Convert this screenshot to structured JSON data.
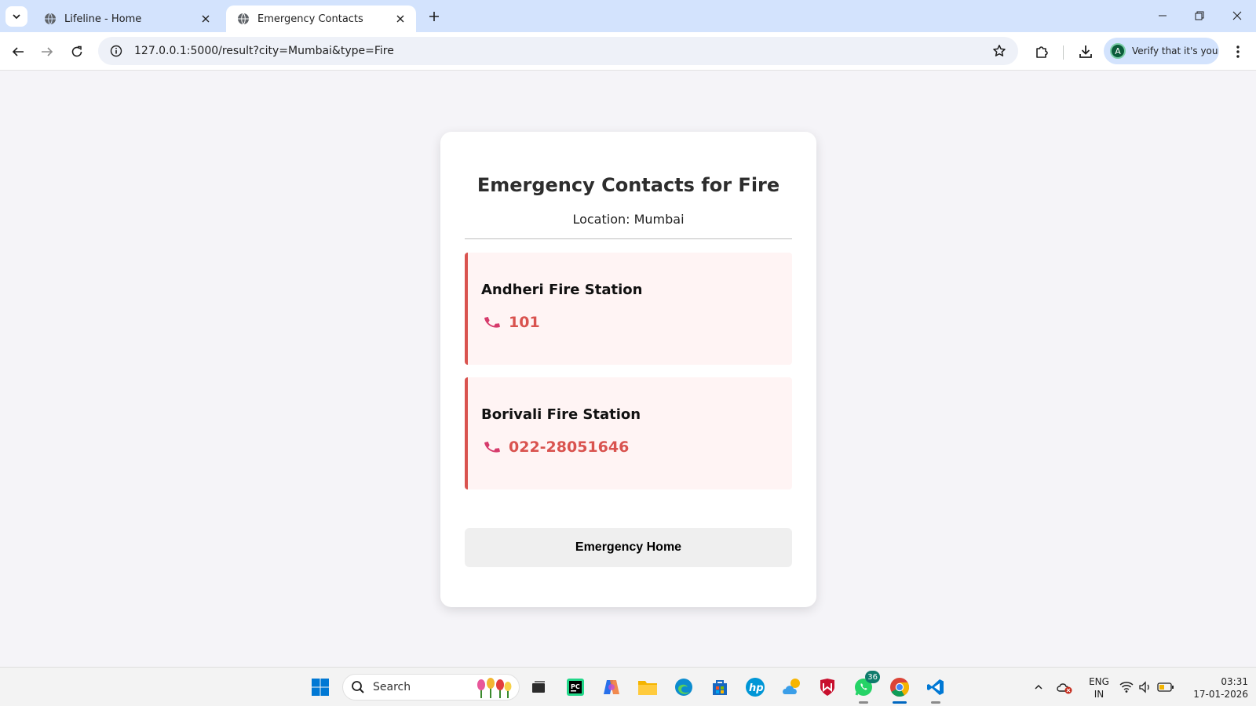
{
  "browser": {
    "tabs": [
      {
        "title": "Lifeline - Home",
        "active": false
      },
      {
        "title": "Emergency Contacts",
        "active": true
      }
    ],
    "url": "127.0.0.1:5000/result?city=Mumbai&type=Fire",
    "profile_label": "Verify that it's you",
    "profile_initial": "A"
  },
  "page": {
    "title": "Emergency Contacts for Fire",
    "location_label": "Location: Mumbai",
    "contacts": [
      {
        "name": "Andheri Fire Station",
        "phone": "101"
      },
      {
        "name": "Borivali Fire Station",
        "phone": "022-28051646"
      }
    ],
    "home_button": "Emergency Home",
    "accent_color": "#d9534f"
  },
  "taskbar": {
    "search_placeholder": "Search",
    "whatsapp_badge": "36",
    "language": {
      "line1": "ENG",
      "line2": "IN"
    },
    "clock": {
      "time": "03:31",
      "date": "17-01-2026"
    }
  }
}
